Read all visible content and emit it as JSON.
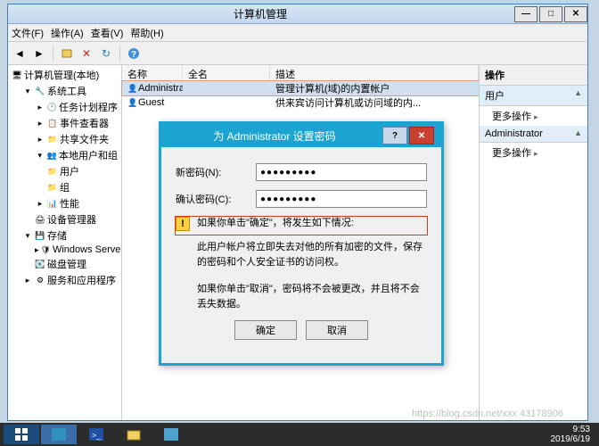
{
  "window": {
    "title": "计算机管理",
    "menu": {
      "file": "文件(F)",
      "action": "操作(A)",
      "view": "查看(V)",
      "help": "帮助(H)"
    }
  },
  "tree": {
    "root": "计算机管理(本地)",
    "systools": "系统工具",
    "scheduler": "任务计划程序",
    "eventviewer": "事件查看器",
    "sharedfolders": "共享文件夹",
    "localusers": "本地用户和组",
    "users": "用户",
    "groups": "组",
    "perf": "性能",
    "devmgr": "设备管理器",
    "storage": "存储",
    "wsb": "Windows Server Back",
    "diskmgr": "磁盘管理",
    "services": "服务和应用程序"
  },
  "list": {
    "headers": {
      "name": "名称",
      "fullname": "全名",
      "desc": "描述"
    },
    "rows": [
      {
        "name": "Administrat...",
        "fullname": "",
        "desc": "管理计算机(域)的内置帐户"
      },
      {
        "name": "Guest",
        "fullname": "",
        "desc": "供来宾访问计算机或访问域的内..."
      }
    ]
  },
  "actions": {
    "header": "操作",
    "section1": "用户",
    "more": "更多操作",
    "section2": "Administrator"
  },
  "dialog": {
    "title": "为 Administrator 设置密码",
    "new_pw_label": "新密码(N):",
    "confirm_pw_label": "确认密码(C):",
    "new_pw_value": "●●●●●●●●●",
    "confirm_pw_value": "●●●●●●●●●",
    "warn_line1": "如果你单击\"确定\"，将发生如下情况:",
    "warn_body": "此用户帐户将立即失去对他的所有加密的文件，保存的密码和个人安全证书的访问权。",
    "cancel_info": "如果你单击\"取消\"，密码将不会被更改，并且将不会丢失数据。",
    "ok": "确定",
    "cancel": "取消"
  },
  "taskbar": {
    "time": "9:53",
    "date": "2019/6/19"
  },
  "watermark": "https://blog.csdn.net/xxx 43178906"
}
